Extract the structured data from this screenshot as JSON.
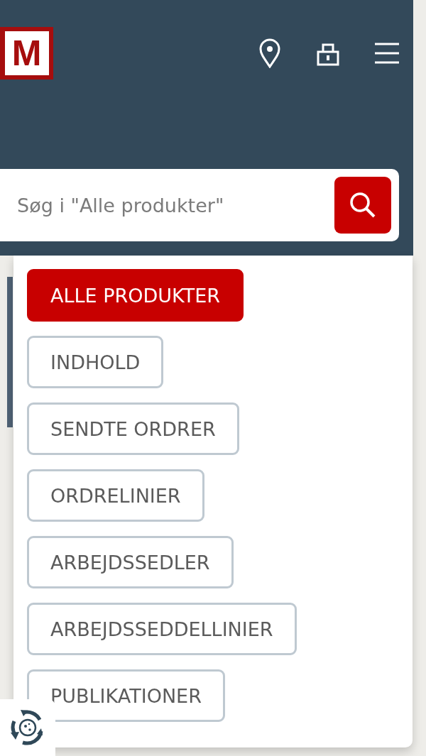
{
  "header": {
    "logo": {
      "text": "M"
    }
  },
  "search": {
    "placeholder": "Søg i \"Alle produkter\""
  },
  "scopes": [
    {
      "label": "ALLE PRODUKTER",
      "selected": true
    },
    {
      "label": "INDHOLD",
      "selected": false
    },
    {
      "label": "SENDTE ORDRER",
      "selected": false
    },
    {
      "label": "ORDRELINIER",
      "selected": false
    },
    {
      "label": "ARBEJDSSEDLER",
      "selected": false
    },
    {
      "label": "ARBEJDSSEDDELLINIER",
      "selected": false
    },
    {
      "label": "PUBLIKATIONER",
      "selected": false
    }
  ]
}
